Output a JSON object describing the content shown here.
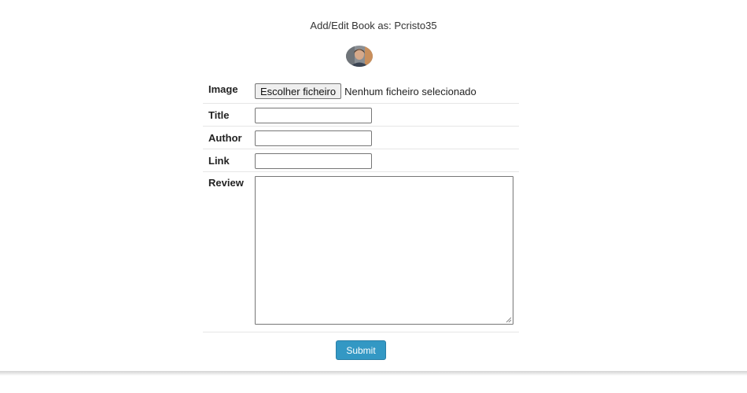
{
  "header": {
    "title": "Add/Edit Book as: Pcristo35"
  },
  "form": {
    "image": {
      "label": "Image",
      "button": "Escolher ficheiro",
      "status": "Nenhum ficheiro selecionado"
    },
    "title": {
      "label": "Title",
      "value": ""
    },
    "author": {
      "label": "Author",
      "value": ""
    },
    "link": {
      "label": "Link",
      "value": ""
    },
    "review": {
      "label": "Review",
      "value": ""
    },
    "submit": "Submit"
  },
  "colors": {
    "accent": "#3398c4"
  }
}
